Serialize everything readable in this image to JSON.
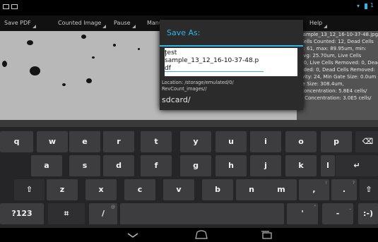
{
  "action_bar": {
    "items": [
      {
        "label": "Save PDF"
      },
      {
        "label": "Counted Image"
      },
      {
        "label": "Pause"
      },
      {
        "label": "Manu"
      },
      {
        "label": "Help"
      }
    ]
  },
  "info_panel": {
    "lines": [
      "sample_13_12_16-10-37-48.jpg",
      "Cells Counted: 12, Dead Cells",
      "d: 61, max: 89.95um, min:",
      "avg: 25.70um, Live Cells",
      ": 0, Live Cells Removed: 0, Dead",
      "dded: 0, Dead Cells Removed:",
      "ivity: 24, Min Gate Size: 0.0um",
      "te Size: 308.4um,",
      "Concentration: 5.8E4 cells/",
      "",
      "ll Concentration: 3.0E5 cells/"
    ]
  },
  "dialog": {
    "title": "Save As:",
    "input_value": "test\nsample_13_12_16-10-37-48.pdf",
    "location": "Location: /storage/emulated/0/\nRevCount_images//",
    "path": "sdcard/"
  },
  "keyboard": {
    "row1": [
      {
        "label": "q"
      },
      {
        "label": "w"
      },
      {
        "label": "e"
      },
      {
        "label": "r"
      },
      {
        "label": "t"
      },
      {
        "label": "y"
      },
      {
        "label": "u"
      },
      {
        "label": "i"
      },
      {
        "label": "o"
      },
      {
        "label": "p"
      },
      {
        "label": "⌫",
        "icon": "backspace-icon"
      }
    ],
    "row2": [
      {
        "label": "a"
      },
      {
        "label": "s"
      },
      {
        "label": "d"
      },
      {
        "label": "f"
      },
      {
        "label": "g"
      },
      {
        "label": "h"
      },
      {
        "label": "j"
      },
      {
        "label": "k"
      },
      {
        "label": "l"
      },
      {
        "label": "↵",
        "icon": "enter-icon"
      }
    ],
    "row3": [
      {
        "label": "⇧",
        "icon": "shift-icon"
      },
      {
        "label": "z"
      },
      {
        "label": "x"
      },
      {
        "label": "c"
      },
      {
        "label": "v"
      },
      {
        "label": "b"
      },
      {
        "label": "n"
      },
      {
        "label": "m"
      },
      {
        "label": ",",
        "hint": "!"
      },
      {
        "label": ".",
        "hint": "?"
      },
      {
        "label": "⇧",
        "icon": "shift-icon"
      }
    ],
    "row4": [
      {
        "label": "?123"
      },
      {
        "label": "⌗",
        "icon": "settings-icon"
      },
      {
        "label": "/",
        "hint": "@"
      },
      {
        "label": "",
        "icon": "space-bar"
      },
      {
        "label": "'",
        "hint": "\""
      },
      {
        "label": "-",
        "hint": "_"
      },
      {
        "label": ":-)"
      }
    ]
  },
  "nav_icons": [
    "back-icon",
    "home-icon",
    "recent-apps-icon"
  ],
  "colors": {
    "accent": "#33b5e5",
    "keyboard_bg": "#252527",
    "key_bg": "#3d3d3f"
  }
}
